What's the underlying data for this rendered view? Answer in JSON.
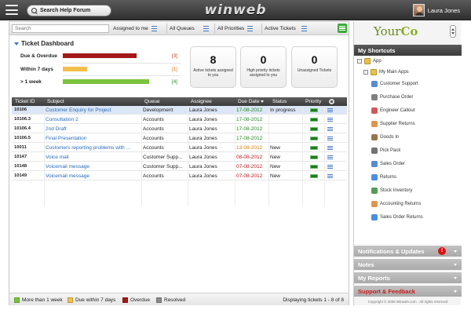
{
  "app": {
    "search_forum_label": "Search Help Forum",
    "logo": "winweb",
    "user_name": "Laura Jones"
  },
  "filters": {
    "search_placeholder": "Search",
    "assigned": "Assigned to me",
    "queues": "All Queues",
    "priorities": "All Priorities",
    "tickets": "Active Tickets"
  },
  "dashboard": {
    "title": "Ticket Dashboard",
    "rows": [
      {
        "label": "Due & Overdue",
        "count": "[3]",
        "fraction": 0.85,
        "color": "#a31919",
        "count_color": "#c0392b"
      },
      {
        "label": "Within 7 days",
        "count": "[1]",
        "fraction": 0.28,
        "color": "#f2bf4a",
        "count_color": "#e67e22"
      },
      {
        "label": "> 1 week",
        "count": "[4]",
        "fraction": 1.0,
        "color": "#7cc33d",
        "count_color": "#2e8b2e"
      }
    ],
    "stats": [
      {
        "num": "8",
        "label": "Active tickets assigned to you"
      },
      {
        "num": "0",
        "label": "High priority tickets assigned to you"
      },
      {
        "num": "0",
        "label": "Unassigned Tickets"
      }
    ]
  },
  "table": {
    "headers": {
      "id": "Ticket ID",
      "subject": "Subject",
      "queue": "Queue",
      "assignee": "Assignee",
      "due": "Due Date",
      "status": "Status",
      "priority": "Priority"
    },
    "rows": [
      {
        "id": "10106",
        "subject": "Customer Enquiry for Project",
        "queue": "Development",
        "assignee": "Laura Jones",
        "due": "17-08-2012",
        "due_color": "#1e8a1e",
        "status": "In progress"
      },
      {
        "id": "10106.3",
        "subject": "Consultation 2",
        "queue": "Accounts",
        "assignee": "Laura Jones",
        "due": "17-08-2012",
        "due_color": "#1e8a1e",
        "status": ""
      },
      {
        "id": "10106.4",
        "subject": "2nd Draft",
        "queue": "Accounts",
        "assignee": "Laura Jones",
        "due": "17-08-2012",
        "due_color": "#1e8a1e",
        "status": ""
      },
      {
        "id": "10106.5",
        "subject": "Final Presentation",
        "queue": "Accounts",
        "assignee": "Laura Jones",
        "due": "17-08-2012",
        "due_color": "#1e8a1e",
        "status": ""
      },
      {
        "id": "10011",
        "subject": "Customers reporting problems with ...",
        "queue": "Accounts",
        "assignee": "Laura Jones",
        "due": "13-08-2012",
        "due_color": "#e07b00",
        "status": "New"
      },
      {
        "id": "10147",
        "subject": "Voice mail",
        "queue": "Customer Supp...",
        "assignee": "Laura Jones",
        "due": "08-08-2012",
        "due_color": "#c0161f",
        "status": "New"
      },
      {
        "id": "10148",
        "subject": "Voicemail message",
        "queue": "Customer Supp...",
        "assignee": "Laura Jones",
        "due": "07-08-2012",
        "due_color": "#c0161f",
        "status": "New"
      },
      {
        "id": "10149",
        "subject": "Voicemail message",
        "queue": "Accounts",
        "assignee": "Laura Jones",
        "due": "07-08-2012",
        "due_color": "#c0161f",
        "status": "New"
      }
    ]
  },
  "footer": {
    "legend": [
      {
        "label": "More than 1 week",
        "color": "#7cc33d"
      },
      {
        "label": "Due within 7 days",
        "color": "#f2bf4a"
      },
      {
        "label": "Overdue",
        "color": "#a31919"
      },
      {
        "label": "Resolved",
        "color": "#8a8a8a"
      }
    ],
    "displaying": "Displaying tickets 1 - 8 of 8"
  },
  "sidebar": {
    "brand_a": "Your",
    "brand_b": "Co",
    "shortcuts_title": "My Shortcuts",
    "tree": {
      "root": "App",
      "group": "My Main Apps",
      "items": [
        {
          "label": "Customer Support",
          "icon": "people-icon"
        },
        {
          "label": "Purchase Order",
          "icon": "document-icon"
        },
        {
          "label": "Engineer Callout",
          "icon": "tools-icon"
        },
        {
          "label": "Supplier Returns",
          "icon": "return-icon"
        },
        {
          "label": "Goods In",
          "icon": "box-icon"
        },
        {
          "label": "Pick Pack",
          "icon": "arrow-icon"
        },
        {
          "label": "Sales Order",
          "icon": "document-icon"
        },
        {
          "label": "Returns",
          "icon": "return-icon"
        },
        {
          "label": "Stock Inventory",
          "icon": "inventory-icon"
        },
        {
          "label": "Accounting Returns",
          "icon": "return-icon"
        },
        {
          "label": "Sales Order Returns",
          "icon": "return-icon"
        }
      ]
    },
    "accordions": {
      "notifications": "Notifications & Updates",
      "notes": "Notes",
      "reports": "My Reports",
      "support": "Support & Feedback"
    },
    "copyright": "Copyright © 2006 Winweb.com · All rights reserved"
  }
}
